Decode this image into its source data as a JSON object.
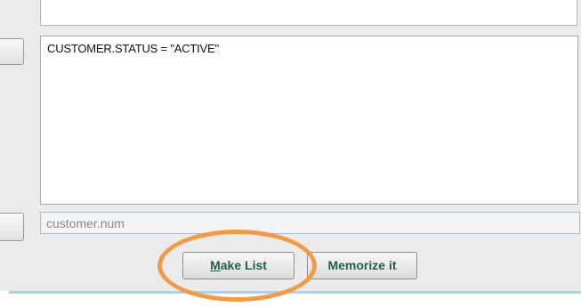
{
  "query": {
    "text": "CUSTOMER.STATUS = \"ACTIVE\""
  },
  "field": {
    "value": "customer.num"
  },
  "buttons": {
    "make_list": {
      "accesskey": "M",
      "rest": "ake List"
    },
    "memorize": {
      "label": "Memorize it"
    }
  },
  "colors": {
    "highlight": "#f39a49",
    "button_text": "#255f4a",
    "footer_line": "#a9d3ea"
  }
}
